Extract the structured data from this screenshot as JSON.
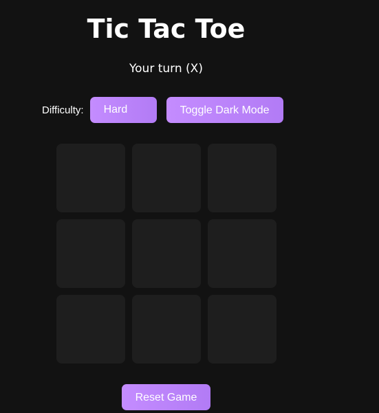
{
  "header": {
    "title": "Tic Tac Toe",
    "status": "Your turn (X)"
  },
  "controls": {
    "difficulty_label": "Difficulty:",
    "difficulty_value": "Hard",
    "toggle_label": "Toggle Dark Mode"
  },
  "board": {
    "cells": [
      "",
      "",
      "",
      "",
      "",
      "",
      "",
      "",
      ""
    ]
  },
  "footer": {
    "reset_label": "Reset Game"
  },
  "colors": {
    "background": "#121212",
    "cell": "#1e1e1e",
    "accent": "#c48cff",
    "text": "#ffffff"
  }
}
